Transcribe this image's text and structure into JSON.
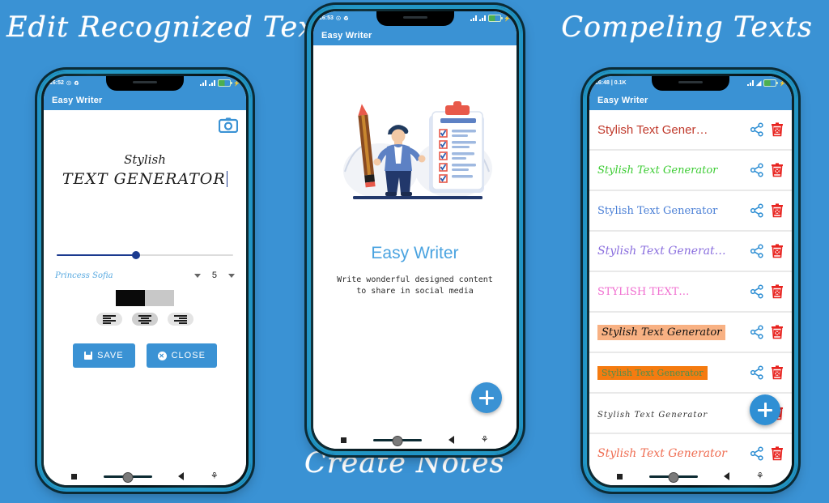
{
  "theme": {
    "background": "#3a92d4",
    "appbar": "#3a92d4",
    "accent": "#3a92d4",
    "fab": "#2f8fd4"
  },
  "headlines": {
    "left": "Edit Recognized Text",
    "right": "Compeling Texts",
    "bottom": "Create Notes"
  },
  "phone1": {
    "status": {
      "time": "16:52",
      "icons": "alarm mute",
      "battery": "charging"
    },
    "appbar_title": "Easy Writer",
    "camera_icon": "camera-icon",
    "editor": {
      "line1": "Stylish",
      "line2": "TEXT GENERATOR"
    },
    "slider": {
      "value": 45
    },
    "font": {
      "name": "Princess Sofia",
      "size": "5"
    },
    "colors": {
      "foreground": "#0a0a0a",
      "background": "#c8c8c8"
    },
    "alignment": {
      "options": [
        "align-left",
        "align-center",
        "align-right"
      ],
      "selected": "align-center"
    },
    "buttons": {
      "save": "SAVE",
      "close": "CLOSE"
    },
    "navbar": [
      "recent-apps",
      "home",
      "back",
      "accessibility"
    ]
  },
  "phone2": {
    "status": {
      "time": "16:53"
    },
    "appbar_title": "Easy Writer",
    "title": "Easy Writer",
    "subtitle": "Write wonderful designed content\nto share in social media",
    "fab_label": "+",
    "illustration": "person-with-pencil-and-checklist"
  },
  "phone3": {
    "status": {
      "time": "16:48 | 0.1K"
    },
    "appbar_title": "Easy Writer",
    "fab_label": "+",
    "items": [
      {
        "text": "Stylish Text Gener…",
        "color": "#c0392b",
        "bg": "transparent",
        "style": "sans",
        "size": 15
      },
      {
        "text": "Stylish Text Generator",
        "color": "#3ccc33",
        "bg": "transparent",
        "style": "script",
        "size": 13
      },
      {
        "text": "Stylish Text Generator",
        "color": "#4a7fd6",
        "bg": "transparent",
        "style": "serif",
        "size": 13
      },
      {
        "text": "Stylish Text Generat…",
        "color": "#8a6ede",
        "bg": "transparent",
        "style": "script",
        "size": 14
      },
      {
        "text": "STYLISH TEXT…",
        "color": "#f06ed0",
        "bg": "transparent",
        "style": "serif",
        "size": 13
      },
      {
        "text": "Stylish Text Generator",
        "color": "#111111",
        "bg": "#f8b183",
        "style": "script",
        "size": 13
      },
      {
        "text": "Stylish Text Generator",
        "color": "#4d8f4d",
        "bg": "#f57b10",
        "style": "serif",
        "size": 11
      },
      {
        "text": "Stylish Text Generator",
        "color": "#333333",
        "bg": "transparent",
        "style": "thin",
        "size": 10
      },
      {
        "text": "Stylish Text Generator",
        "color": "#ef6d52",
        "bg": "transparent",
        "style": "script",
        "size": 14
      }
    ],
    "row_actions": {
      "share": "share-icon",
      "delete": "delete-icon"
    }
  }
}
